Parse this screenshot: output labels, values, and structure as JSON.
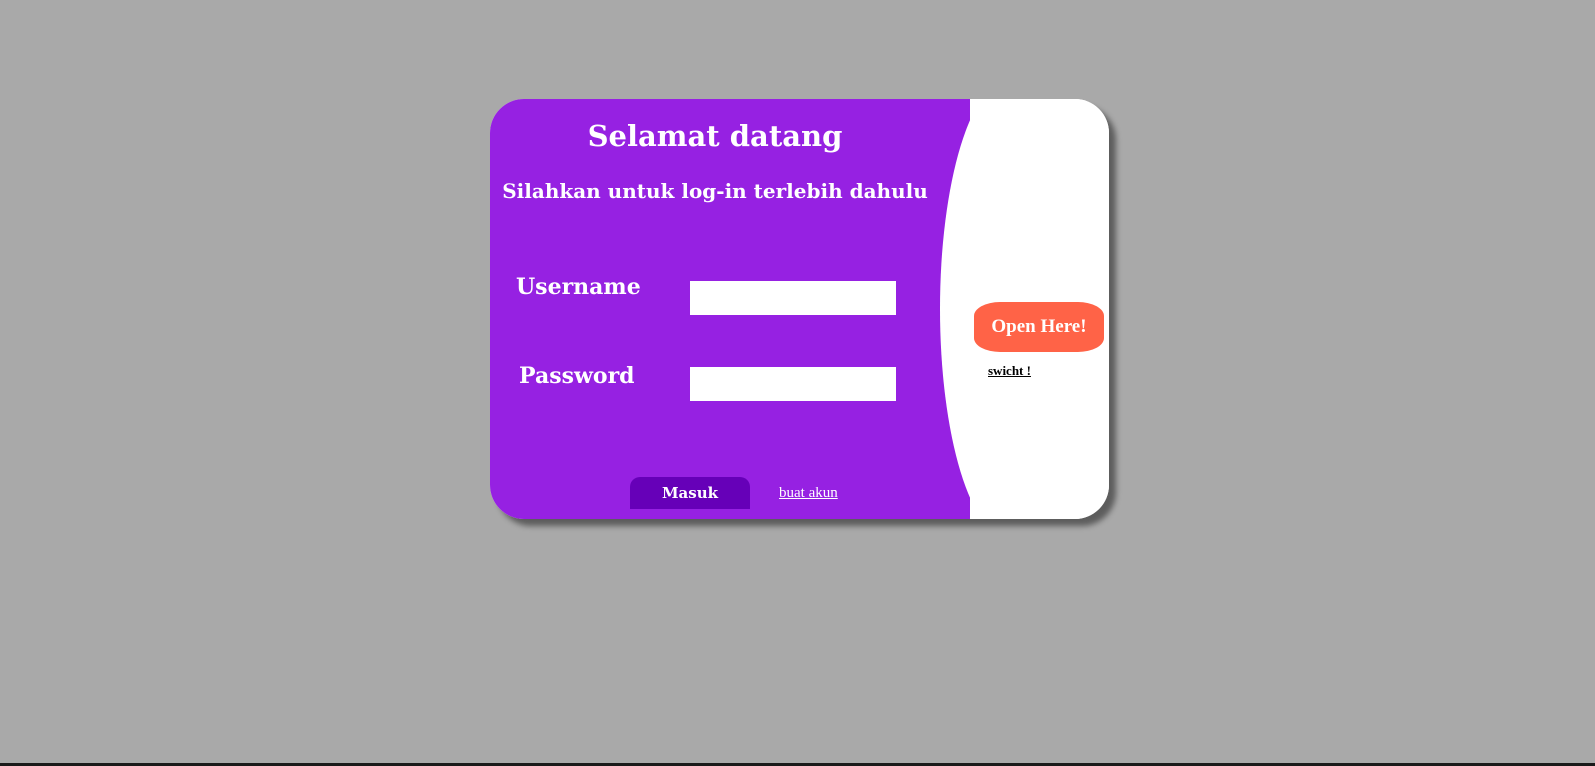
{
  "page": {
    "background_color": "#a9a9a9"
  },
  "card": {
    "left_panel_color": "#9621e2",
    "right_panel_color": "#ffffff",
    "title": "Selamat datang",
    "subtitle": "Silahkan untuk log-in terlebih dahulu",
    "form": {
      "username_label": "Username",
      "username_value": "",
      "password_label": "Password",
      "password_value": "",
      "submit_label": "Masuk",
      "submit_color": "#6600b8",
      "create_account_label": "buat akun"
    },
    "side_panel": {
      "open_label": "Open Here!",
      "open_color": "#ff6347",
      "switch_label": "swicht !"
    }
  }
}
